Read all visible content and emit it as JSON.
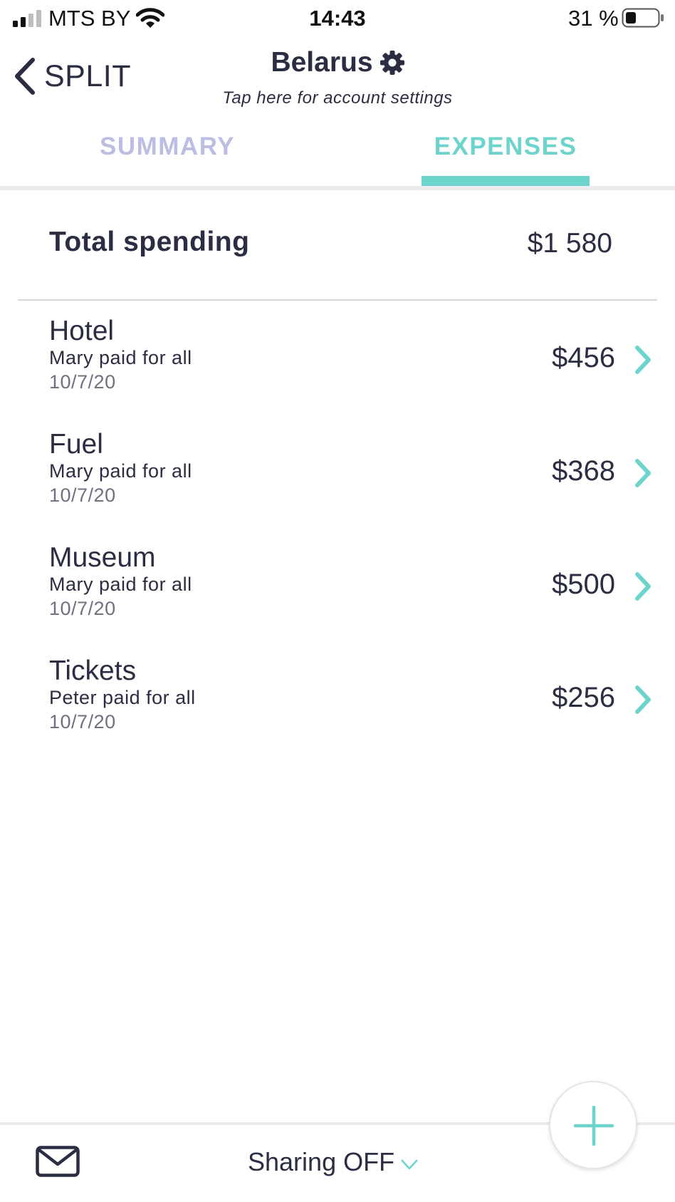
{
  "status_bar": {
    "carrier": "MTS BY",
    "time": "14:43",
    "battery": "31 %",
    "icons": [
      "signal-icon",
      "wifi-icon",
      "battery-icon"
    ]
  },
  "header": {
    "back_label": "SPLIT",
    "account_name": "Belarus",
    "account_subtitle": "Tap here for account settings",
    "icons": [
      "chevron-left-icon",
      "gear-icon"
    ]
  },
  "tabs": [
    {
      "label": "SUMMARY",
      "active": false
    },
    {
      "label": "EXPENSES",
      "active": true
    }
  ],
  "total": {
    "label": "Total spending",
    "value": "$1 580"
  },
  "expenses": [
    {
      "name": "Hotel",
      "payer": "Mary paid for all",
      "date": "10/7/20",
      "amount": "$456"
    },
    {
      "name": "Fuel",
      "payer": "Mary paid for all",
      "date": "10/7/20",
      "amount": "$368"
    },
    {
      "name": "Museum",
      "payer": "Mary paid for all",
      "date": "10/7/20",
      "amount": "$500"
    },
    {
      "name": "Tickets",
      "payer": "Peter paid for all",
      "date": "10/7/20",
      "amount": "$256"
    }
  ],
  "bottom_bar": {
    "sharing_label": "Sharing OFF",
    "icons": [
      "mail-icon",
      "chevron-down-icon",
      "plus-icon"
    ]
  },
  "colors": {
    "accent": "#6dd4cc",
    "inactive_tab": "#bcbde3",
    "text": "#2b2d42",
    "secondary_text": "#6f7080"
  }
}
